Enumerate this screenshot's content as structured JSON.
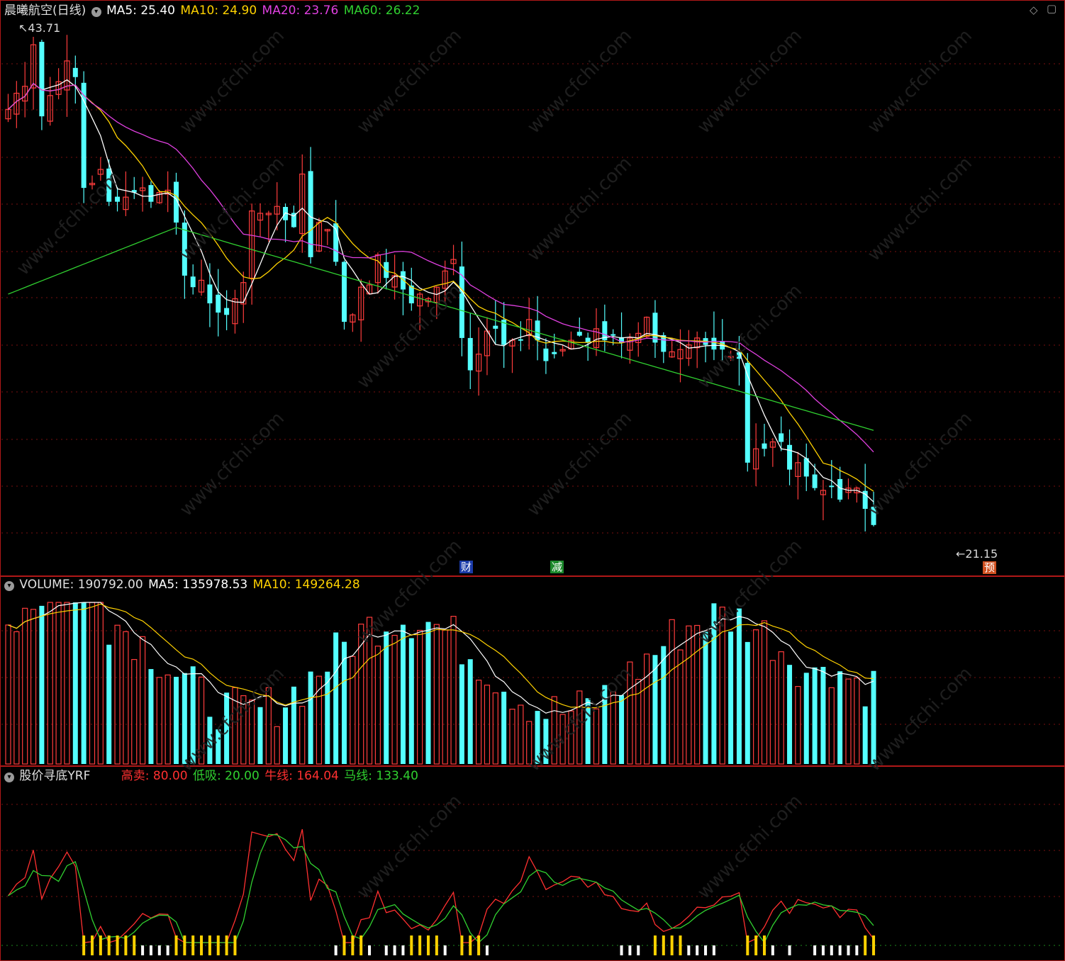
{
  "main": {
    "title": "晨曦航空(日线)",
    "ma5_label": "MA5: 25.40",
    "ma10_label": "MA10: 24.90",
    "ma20_label": "MA20: 23.76",
    "ma60_label": "MA60: 26.22",
    "high_label": "43.71",
    "low_label": "21.15",
    "tag_cai": "财",
    "tag_jian": "减",
    "tag_yu": "预"
  },
  "volume": {
    "title": "VOLUME: 190792.00",
    "ma5_label": "MA5: 135978.53",
    "ma10_label": "MA10: 149264.28"
  },
  "indicator": {
    "title": "股价寻底YRF",
    "gao_label": "高卖: 80.00",
    "di_label": "低吸: 20.00",
    "niu_label": "牛线: 164.04",
    "ma_label": "马线: 133.40"
  },
  "colors": {
    "up": "#ff3c3c",
    "down": "#54ffff",
    "ma5": "#ffffff",
    "ma10": "#ffd200",
    "ma20": "#e040e0",
    "ma60": "#30d030",
    "frame": "#b01818"
  },
  "chart_data": {
    "type": "candlestick",
    "series_count": 104,
    "price_axis": {
      "high_marker": 43.71,
      "low_marker": 21.15
    },
    "ma_last": {
      "MA5": 25.4,
      "MA10": 24.9,
      "MA20": 23.76,
      "MA60": 26.22
    },
    "volume_last": {
      "VOLUME": 190792.0,
      "MA5": 135978.53,
      "MA10": 149264.28
    },
    "indicator_last": {
      "高卖": 80.0,
      "低吸": 20.0,
      "牛线": 164.04,
      "马线": 133.4
    },
    "close": [
      40.2,
      40.9,
      41.2,
      43.0,
      39.9,
      40.8,
      41.4,
      42.3,
      41.6,
      36.8,
      37.0,
      37.6,
      36.2,
      36.2,
      36.4,
      36.6,
      36.8,
      36.2,
      36.6,
      36.7,
      35.3,
      33.0,
      32.5,
      32.8,
      31.8,
      31.4,
      31.3,
      32.0,
      32.7,
      35.8,
      35.7,
      35.7,
      36.0,
      35.4,
      35.1,
      37.4,
      33.8,
      35.3,
      35.0,
      33.6,
      31.0,
      31.3,
      32.5,
      32.6,
      33.9,
      32.9,
      33.0,
      32.4,
      31.8,
      32.2,
      32.0,
      32.5,
      33.2,
      33.7,
      30.3,
      28.9,
      29.6,
      30.6,
      30.7,
      30.0,
      30.2,
      30.2,
      31.1,
      30.2,
      29.3,
      29.6,
      29.8,
      30.2,
      30.4,
      30.1,
      30.7,
      30.2,
      30.4,
      30.1,
      30.3,
      30.5,
      31.2,
      30.1,
      29.7,
      29.7,
      29.8,
      30.0,
      30.3,
      30.0,
      29.8,
      29.8,
      29.5,
      29.4,
      24.9,
      25.5,
      25.5,
      25.8,
      25.8,
      24.6,
      24.9,
      24.3,
      23.8,
      23.7,
      23.9,
      23.3,
      23.8,
      23.8,
      22.9,
      22.2
    ]
  }
}
